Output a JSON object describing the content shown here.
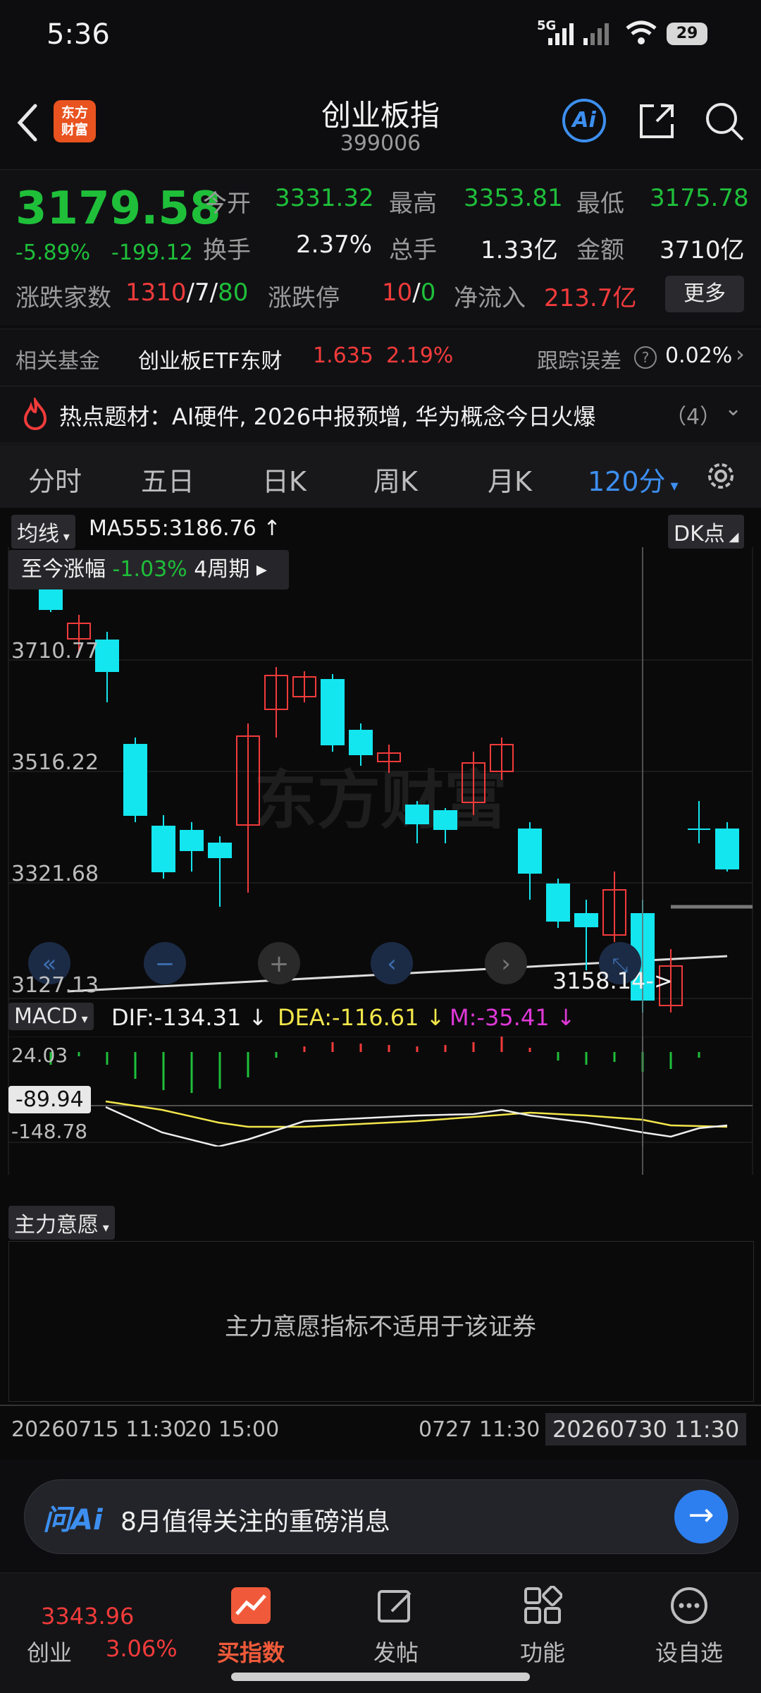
{
  "status": {
    "time": "5:36",
    "battery": "29",
    "network": "5G"
  },
  "header": {
    "title": "创业板指",
    "code": "399006",
    "logo_line1": "东方",
    "logo_line2": "财富",
    "ai_label": "Ai"
  },
  "quote": {
    "price": "3179.58",
    "change_pct": "-5.89%",
    "change": "-199.12",
    "open_label": "今开",
    "open": "3331.32",
    "high_label": "最高",
    "high": "3353.81",
    "low_label": "最低",
    "low": "3175.78",
    "turnover_label": "换手",
    "turnover": "2.37%",
    "volume_label": "总手",
    "volume": "1.33亿",
    "amount_label": "金额",
    "amount": "3710亿",
    "breadth_label": "涨跌家数",
    "breadth_up": "1310",
    "breadth_flat": "7",
    "breadth_down": "80",
    "sep": "/",
    "limit_label": "涨跌停",
    "limit_up": "10",
    "limit_down": "0",
    "netflow_label": "净流入",
    "netflow": "213.7亿",
    "more": "更多"
  },
  "fund": {
    "label": "相关基金",
    "name": "创业板ETF东财",
    "price": "1.635",
    "pct": "2.19%",
    "track_label": "跟踪误差",
    "track_value": "0.02%"
  },
  "topic": {
    "text": "热点题材：AI硬件, 2026中报预增, 华为概念今日火爆",
    "count": "（4）"
  },
  "tabs": [
    "分时",
    "五日",
    "日K",
    "周K",
    "月K",
    "120分"
  ],
  "chart": {
    "ma_tag": "均线",
    "ma_text": "MA555:3186.76 ↑",
    "dk_tag": "DK点",
    "range_label": "至今涨幅",
    "range_value": "-1.03%",
    "range_period": "4周期",
    "y_labels": [
      "3710.77",
      "3516.22",
      "3321.68",
      "3127.13"
    ],
    "cursor_label": "3158.14->",
    "macd_tag": "MACD",
    "dif": "DIF:-134.31 ↓",
    "dea": "DEA:-116.61 ↓",
    "m": "M:-35.41 ↓",
    "macd_top": "24.03",
    "macd_cur": "-89.94",
    "macd_bot": "-148.78",
    "zlyy_tag": "主力意愿",
    "zlyy_msg": "主力意愿指标不适用于该证券",
    "x_labels": [
      "20260715 11:30",
      "20 15:00",
      "0727 11:30",
      "20260730 11:30"
    ]
  },
  "ai": {
    "logo": "问Ai",
    "text": "8月值得关注的重磅消息"
  },
  "nav": {
    "index_price": "3343.96",
    "index_name": "创业",
    "index_pct": "3.06%",
    "items": [
      "买指数",
      "发帖",
      "功能",
      "设自选"
    ]
  }
}
